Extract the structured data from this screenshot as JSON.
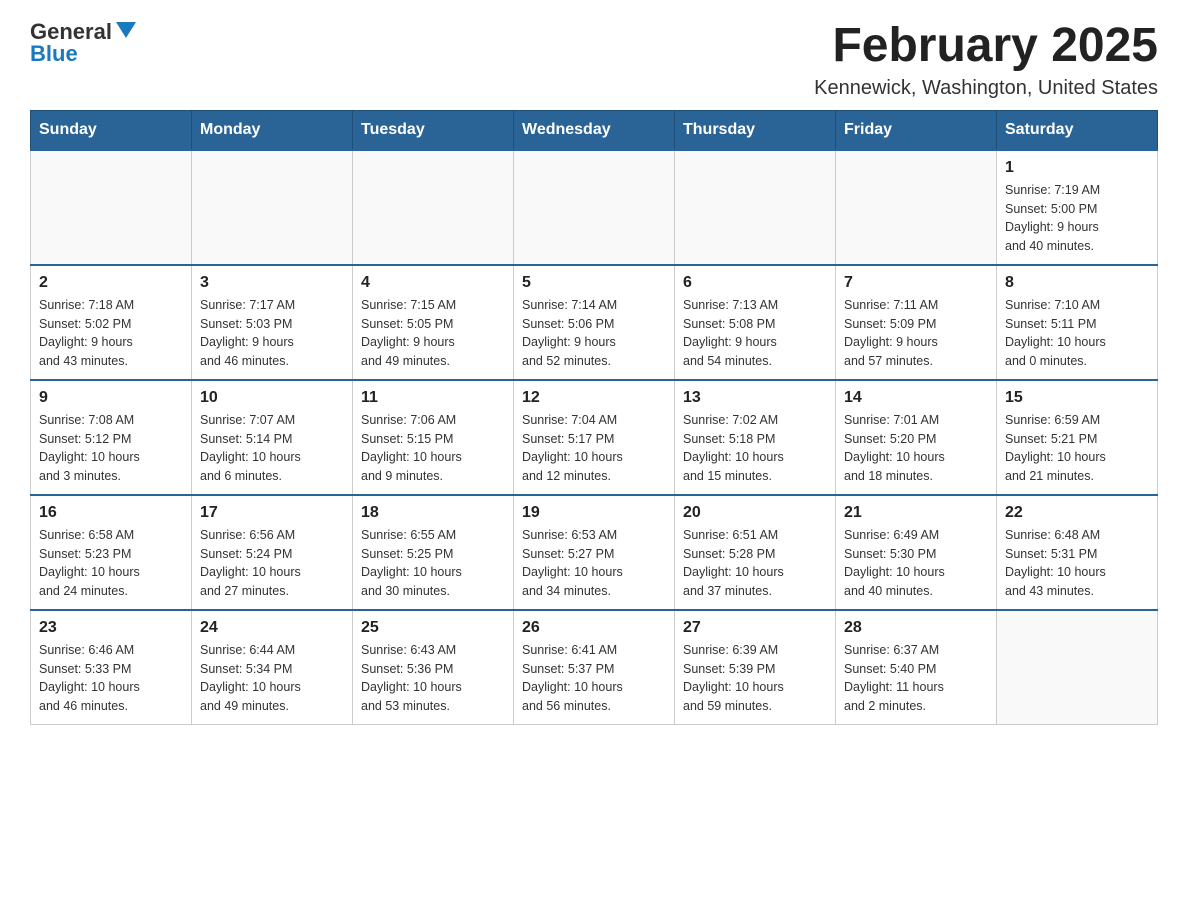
{
  "logo": {
    "general": "General",
    "blue": "Blue"
  },
  "title": "February 2025",
  "subtitle": "Kennewick, Washington, United States",
  "days_of_week": [
    "Sunday",
    "Monday",
    "Tuesday",
    "Wednesday",
    "Thursday",
    "Friday",
    "Saturday"
  ],
  "weeks": [
    [
      {
        "day": "",
        "info": ""
      },
      {
        "day": "",
        "info": ""
      },
      {
        "day": "",
        "info": ""
      },
      {
        "day": "",
        "info": ""
      },
      {
        "day": "",
        "info": ""
      },
      {
        "day": "",
        "info": ""
      },
      {
        "day": "1",
        "info": "Sunrise: 7:19 AM\nSunset: 5:00 PM\nDaylight: 9 hours\nand 40 minutes."
      }
    ],
    [
      {
        "day": "2",
        "info": "Sunrise: 7:18 AM\nSunset: 5:02 PM\nDaylight: 9 hours\nand 43 minutes."
      },
      {
        "day": "3",
        "info": "Sunrise: 7:17 AM\nSunset: 5:03 PM\nDaylight: 9 hours\nand 46 minutes."
      },
      {
        "day": "4",
        "info": "Sunrise: 7:15 AM\nSunset: 5:05 PM\nDaylight: 9 hours\nand 49 minutes."
      },
      {
        "day": "5",
        "info": "Sunrise: 7:14 AM\nSunset: 5:06 PM\nDaylight: 9 hours\nand 52 minutes."
      },
      {
        "day": "6",
        "info": "Sunrise: 7:13 AM\nSunset: 5:08 PM\nDaylight: 9 hours\nand 54 minutes."
      },
      {
        "day": "7",
        "info": "Sunrise: 7:11 AM\nSunset: 5:09 PM\nDaylight: 9 hours\nand 57 minutes."
      },
      {
        "day": "8",
        "info": "Sunrise: 7:10 AM\nSunset: 5:11 PM\nDaylight: 10 hours\nand 0 minutes."
      }
    ],
    [
      {
        "day": "9",
        "info": "Sunrise: 7:08 AM\nSunset: 5:12 PM\nDaylight: 10 hours\nand 3 minutes."
      },
      {
        "day": "10",
        "info": "Sunrise: 7:07 AM\nSunset: 5:14 PM\nDaylight: 10 hours\nand 6 minutes."
      },
      {
        "day": "11",
        "info": "Sunrise: 7:06 AM\nSunset: 5:15 PM\nDaylight: 10 hours\nand 9 minutes."
      },
      {
        "day": "12",
        "info": "Sunrise: 7:04 AM\nSunset: 5:17 PM\nDaylight: 10 hours\nand 12 minutes."
      },
      {
        "day": "13",
        "info": "Sunrise: 7:02 AM\nSunset: 5:18 PM\nDaylight: 10 hours\nand 15 minutes."
      },
      {
        "day": "14",
        "info": "Sunrise: 7:01 AM\nSunset: 5:20 PM\nDaylight: 10 hours\nand 18 minutes."
      },
      {
        "day": "15",
        "info": "Sunrise: 6:59 AM\nSunset: 5:21 PM\nDaylight: 10 hours\nand 21 minutes."
      }
    ],
    [
      {
        "day": "16",
        "info": "Sunrise: 6:58 AM\nSunset: 5:23 PM\nDaylight: 10 hours\nand 24 minutes."
      },
      {
        "day": "17",
        "info": "Sunrise: 6:56 AM\nSunset: 5:24 PM\nDaylight: 10 hours\nand 27 minutes."
      },
      {
        "day": "18",
        "info": "Sunrise: 6:55 AM\nSunset: 5:25 PM\nDaylight: 10 hours\nand 30 minutes."
      },
      {
        "day": "19",
        "info": "Sunrise: 6:53 AM\nSunset: 5:27 PM\nDaylight: 10 hours\nand 34 minutes."
      },
      {
        "day": "20",
        "info": "Sunrise: 6:51 AM\nSunset: 5:28 PM\nDaylight: 10 hours\nand 37 minutes."
      },
      {
        "day": "21",
        "info": "Sunrise: 6:49 AM\nSunset: 5:30 PM\nDaylight: 10 hours\nand 40 minutes."
      },
      {
        "day": "22",
        "info": "Sunrise: 6:48 AM\nSunset: 5:31 PM\nDaylight: 10 hours\nand 43 minutes."
      }
    ],
    [
      {
        "day": "23",
        "info": "Sunrise: 6:46 AM\nSunset: 5:33 PM\nDaylight: 10 hours\nand 46 minutes."
      },
      {
        "day": "24",
        "info": "Sunrise: 6:44 AM\nSunset: 5:34 PM\nDaylight: 10 hours\nand 49 minutes."
      },
      {
        "day": "25",
        "info": "Sunrise: 6:43 AM\nSunset: 5:36 PM\nDaylight: 10 hours\nand 53 minutes."
      },
      {
        "day": "26",
        "info": "Sunrise: 6:41 AM\nSunset: 5:37 PM\nDaylight: 10 hours\nand 56 minutes."
      },
      {
        "day": "27",
        "info": "Sunrise: 6:39 AM\nSunset: 5:39 PM\nDaylight: 10 hours\nand 59 minutes."
      },
      {
        "day": "28",
        "info": "Sunrise: 6:37 AM\nSunset: 5:40 PM\nDaylight: 11 hours\nand 2 minutes."
      },
      {
        "day": "",
        "info": ""
      }
    ]
  ]
}
